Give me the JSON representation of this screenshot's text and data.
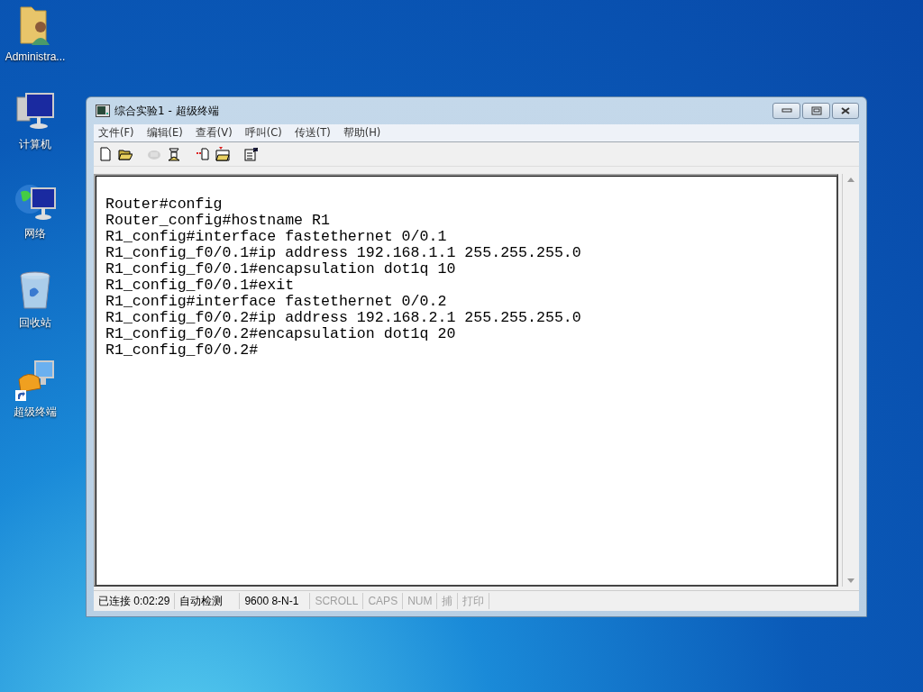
{
  "desktop_icons": [
    {
      "kind": "user-folder",
      "label": "Administra..."
    },
    {
      "kind": "computer",
      "label": "计算机"
    },
    {
      "kind": "network",
      "label": "网络"
    },
    {
      "kind": "recycle-bin",
      "label": "回收站"
    },
    {
      "kind": "terminal-shortcut",
      "label": "超级终端"
    }
  ],
  "window": {
    "title": "综合实验1 - 超级终端",
    "menu": [
      "文件(F)",
      "编辑(E)",
      "查看(V)",
      "呼叫(C)",
      "传送(T)",
      "帮助(H)"
    ],
    "toolbar": [
      {
        "kind": "new",
        "disabled": false
      },
      {
        "kind": "open",
        "disabled": false
      },
      {
        "kind": "call",
        "disabled": true
      },
      {
        "kind": "hangup",
        "disabled": false
      },
      {
        "kind": "send",
        "disabled": false
      },
      {
        "kind": "receive",
        "disabled": false
      },
      {
        "kind": "properties",
        "disabled": false
      }
    ],
    "terminal_lines": [
      "Router#config",
      "Router_config#hostname R1",
      "R1_config#interface fastethernet 0/0.1",
      "R1_config_f0/0.1#ip address 192.168.1.1 255.255.255.0",
      "R1_config_f0/0.1#encapsulation dot1q 10",
      "R1_config_f0/0.1#exit",
      "R1_config#interface fastethernet 0/0.2",
      "R1_config_f0/0.2#ip address 192.168.2.1 255.255.255.0",
      "R1_config_f0/0.2#encapsulation dot1q 20",
      "R1_config_f0/0.2#"
    ],
    "status_bar": [
      {
        "text": "已连接 0:02:29",
        "disabled": false
      },
      {
        "text": "自动检测",
        "disabled": false
      },
      {
        "text": "9600 8-N-1",
        "disabled": false
      },
      {
        "text": "SCROLL",
        "disabled": true
      },
      {
        "text": "CAPS",
        "disabled": true
      },
      {
        "text": "NUM",
        "disabled": true
      },
      {
        "text": "捕",
        "disabled": true
      },
      {
        "text": "打印",
        "disabled": true
      }
    ]
  }
}
